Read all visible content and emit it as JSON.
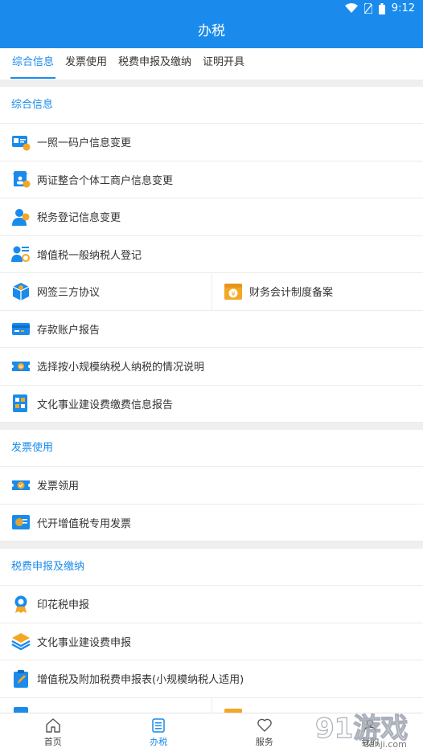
{
  "status": {
    "time": "9:12"
  },
  "appbar": {
    "title": "办税"
  },
  "tabs": [
    "综合信息",
    "发票使用",
    "税费申报及缴纳",
    "证明开具"
  ],
  "sections": {
    "general": {
      "title": "综合信息",
      "items": [
        "一照一码户信息变更",
        "两证整合个体工商户信息变更",
        "税务登记信息变更",
        "增值税一般纳税人登记",
        "网签三方协议",
        "财务会计制度备案",
        "存款账户报告",
        "选择按小规模纳税人纳税的情况说明",
        "文化事业建设费缴费信息报告"
      ]
    },
    "invoice": {
      "title": "发票使用",
      "items": [
        "发票领用",
        "代开增值税专用发票"
      ]
    },
    "declare": {
      "title": "税费申报及缴纳",
      "items": [
        "印花税申报",
        "文化事业建设费申报",
        "增值税及附加税费申报表(小规模纳税人适用)"
      ]
    }
  },
  "bottom_nav": [
    "首页",
    "办税",
    "服务",
    "我的"
  ],
  "watermark": {
    "text": "91游戏",
    "url": "danji.com"
  },
  "colors": {
    "primary": "#1a8bec",
    "accent": "#f5a623"
  }
}
